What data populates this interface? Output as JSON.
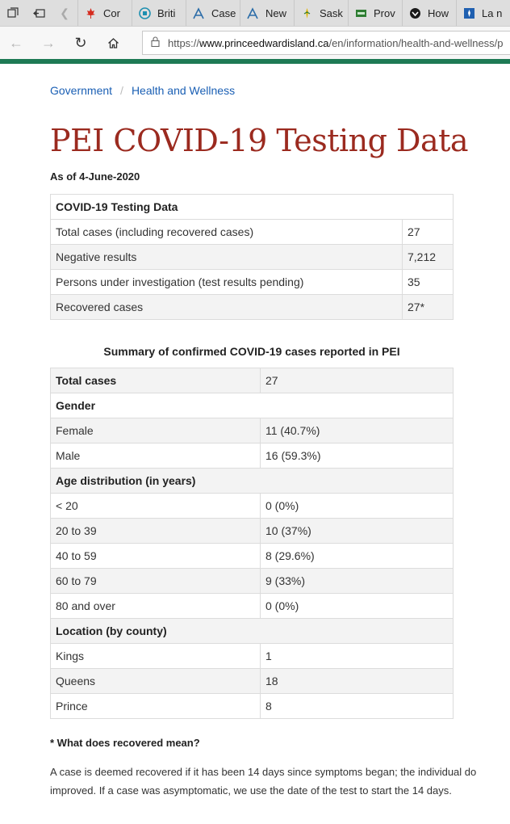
{
  "browser": {
    "tabs": [
      {
        "label": "Cor",
        "icon": "canada-flag-icon"
      },
      {
        "label": "Briti",
        "icon": "bc-logo-icon"
      },
      {
        "label": "Case",
        "icon": "alberta-logo-icon"
      },
      {
        "label": "New",
        "icon": "alberta-logo-icon"
      },
      {
        "label": "Sask",
        "icon": "saskatchewan-logo-icon"
      },
      {
        "label": "Prov",
        "icon": "manitoba-logo-icon"
      },
      {
        "label": "How",
        "icon": "ontario-logo-icon"
      },
      {
        "label": "La n",
        "icon": "quebec-logo-icon"
      }
    ],
    "url_prefix": "https://",
    "url_host": "www.princeedwardisland.ca",
    "url_path": "/en/information/health-and-wellness/p"
  },
  "breadcrumb": [
    "Government",
    "Health and Wellness"
  ],
  "page": {
    "title": "PEI COVID-19 Testing Data",
    "as_of": "As of 4-June-2020"
  },
  "testing_table": {
    "header": "COVID-19 Testing Data",
    "rows": [
      {
        "label": "Total cases (including recovered cases)",
        "value": "27"
      },
      {
        "label": "Negative results",
        "value": "7,212"
      },
      {
        "label": "Persons under investigation (test results pending)",
        "value": "35"
      },
      {
        "label": "Recovered cases",
        "value": "27*"
      }
    ]
  },
  "summary_table": {
    "caption": "Summary of confirmed COVID-19 cases reported in PEI",
    "total_label": "Total cases",
    "total_value": "27",
    "gender_header": "Gender",
    "gender": [
      {
        "label": "Female",
        "value": "11 (40.7%)"
      },
      {
        "label": "Male",
        "value": "16 (59.3%)"
      }
    ],
    "age_header": "Age distribution (in years)",
    "age": [
      {
        "label": "< 20",
        "value": "0 (0%)"
      },
      {
        "label": "20 to 39",
        "value": "10 (37%)"
      },
      {
        "label": "40 to 59",
        "value": "8 (29.6%)"
      },
      {
        "label": "60 to 79",
        "value": "9 (33%)"
      },
      {
        "label": "80 and over",
        "value": "0 (0%)"
      }
    ],
    "location_header": "Location (by county)",
    "location": [
      {
        "label": "Kings",
        "value": "1"
      },
      {
        "label": "Queens",
        "value": "18"
      },
      {
        "label": "Prince",
        "value": "8"
      }
    ]
  },
  "recovered": {
    "question": "* What does recovered mean?",
    "line1": "A case is deemed recovered if it has been 14 days since symptoms began; the individual do",
    "line2": "improved. If a case was asymptomatic, we use the date of the test to start the 14 days."
  },
  "colors": {
    "title": "#9b2a1f",
    "link": "#1a5fb4",
    "accent_bar": "#1e7a55"
  }
}
